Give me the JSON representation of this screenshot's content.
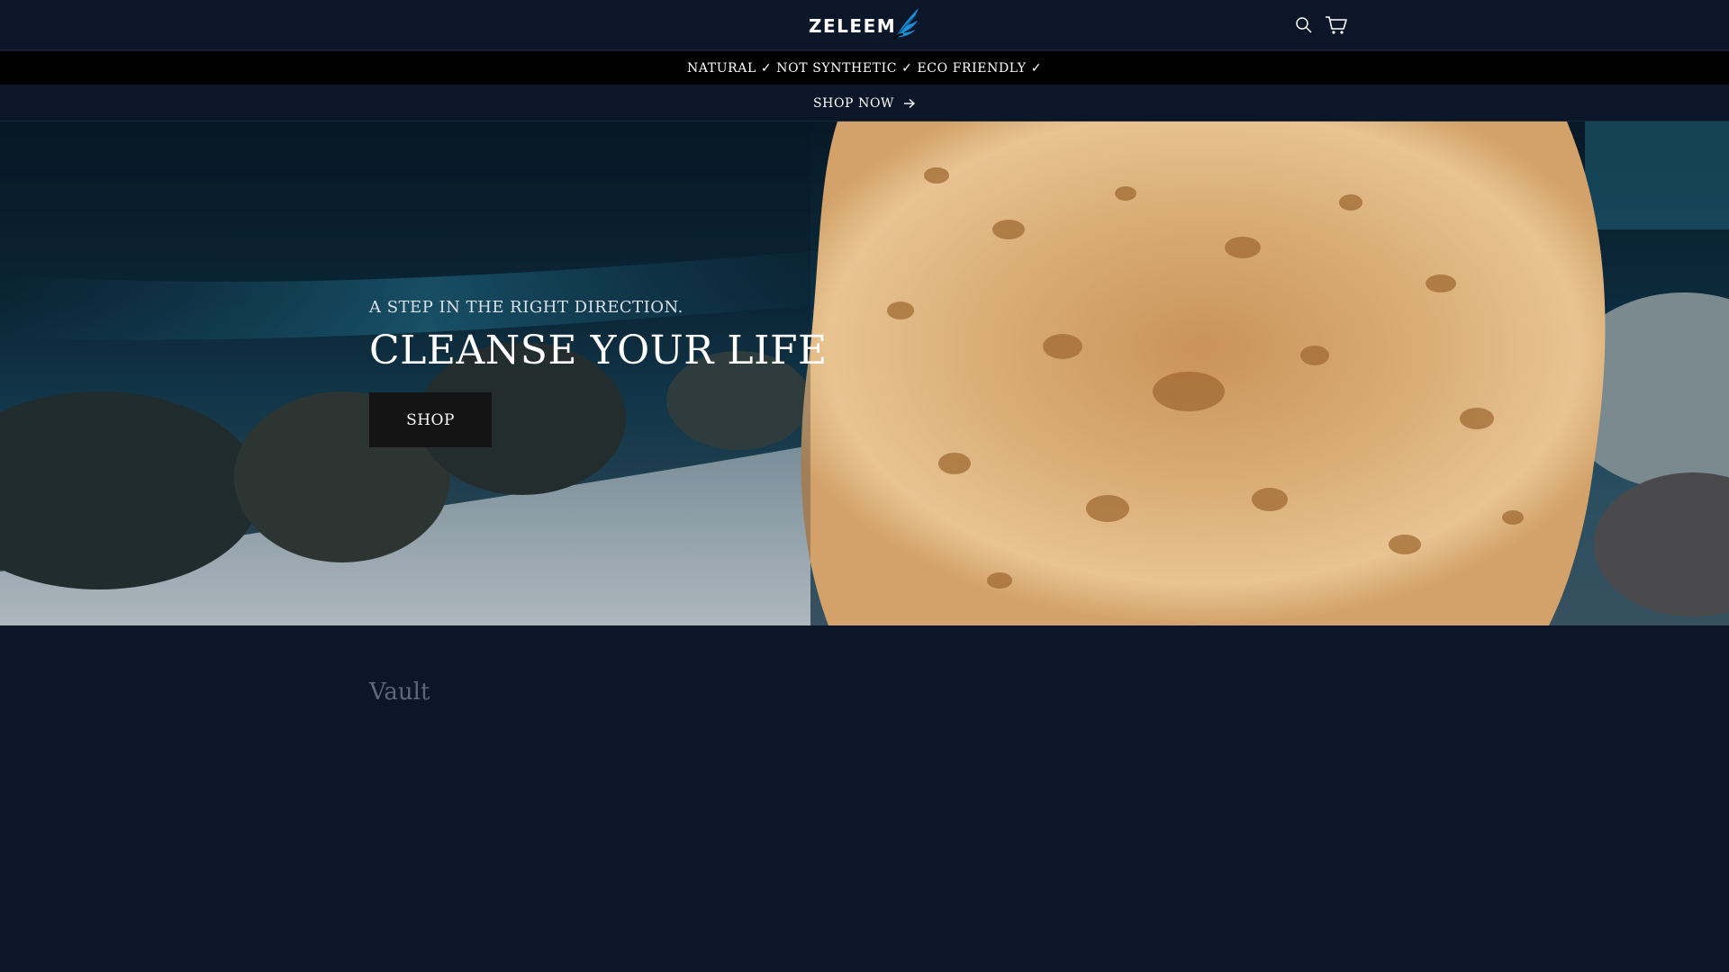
{
  "header": {
    "logo_text": "ZELEEM",
    "search_icon": "search-icon",
    "cart_icon": "cart-icon"
  },
  "announcement": {
    "text": "NATURAL ✓ NOT SYNTHETIC ✓ ECO FRIENDLY ✓"
  },
  "shopnow_bar": {
    "label": "SHOP NOW",
    "icon": "arrow-right-icon"
  },
  "hero": {
    "eyebrow": "A STEP IN THE RIGHT DIRECTION.",
    "title": "CLEANSE YOUR LIFE",
    "button_label": "SHOP"
  },
  "section": {
    "title": "Vault"
  },
  "colors": {
    "page_background": "#0b1729",
    "announcement_background": "#000000",
    "button_background": "#141414",
    "logo_accent": "#1a8fd6"
  }
}
